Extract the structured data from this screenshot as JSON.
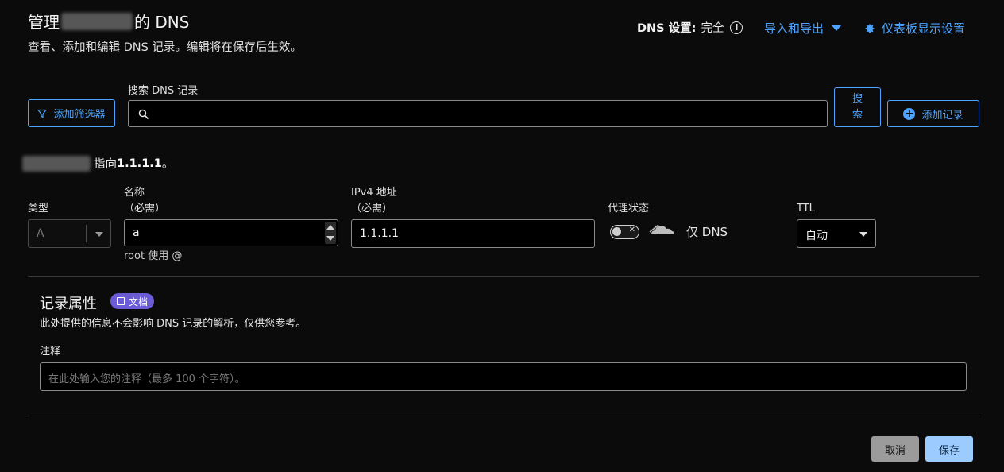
{
  "header": {
    "title_prefix": "管理",
    "title_suffix": "的 DNS",
    "subtitle": "查看、添加和编辑 DNS 记录。编辑将在保存后生效。",
    "dns_setting_label": "DNS 设置:",
    "dns_setting_value": "完全",
    "import_export": "导入和导出",
    "dashboard_settings": "仪表板显示设置"
  },
  "toolbar": {
    "add_filter": "添加筛选器",
    "search_label": "搜索 DNS 记录",
    "search_value": "",
    "search_button_line1": "搜",
    "search_button_line2": "索",
    "add_record": "添加记录"
  },
  "record": {
    "points_to_prefix": "指向",
    "points_to_value": "1.1.1.1",
    "points_to_suffix": "。",
    "type_label": "类型",
    "type_value": "A",
    "name_label": "名称",
    "name_required": "（必需）",
    "name_value": "a",
    "name_hint": "root 使用 @",
    "ipv4_label": "IPv4 地址",
    "ipv4_required": "（必需）",
    "ipv4_value": "1.1.1.1",
    "proxy_label": "代理状态",
    "proxy_value": "仅 DNS",
    "proxy_enabled": false,
    "ttl_label": "TTL",
    "ttl_value": "自动"
  },
  "properties": {
    "title": "记录属性",
    "docs_badge": "文档",
    "description": "此处提供的信息不会影响 DNS 记录的解析，仅供您参考。",
    "comment_label": "注释",
    "comment_value": "",
    "comment_placeholder": "在此处输入您的注释（最多 100 个字符）。"
  },
  "actions": {
    "cancel": "取消",
    "save": "保存"
  },
  "colors": {
    "background": "#0b0b0b",
    "accent": "#4da3ff",
    "badge": "#6b5bd6",
    "save_button": "#9ccbff",
    "cancel_button": "#9b9b9b"
  },
  "icons": [
    "info-icon",
    "chevron-down-icon",
    "gear-icon",
    "filter-icon",
    "search-icon",
    "plus-circle-icon",
    "cloud-icon",
    "book-icon"
  ]
}
